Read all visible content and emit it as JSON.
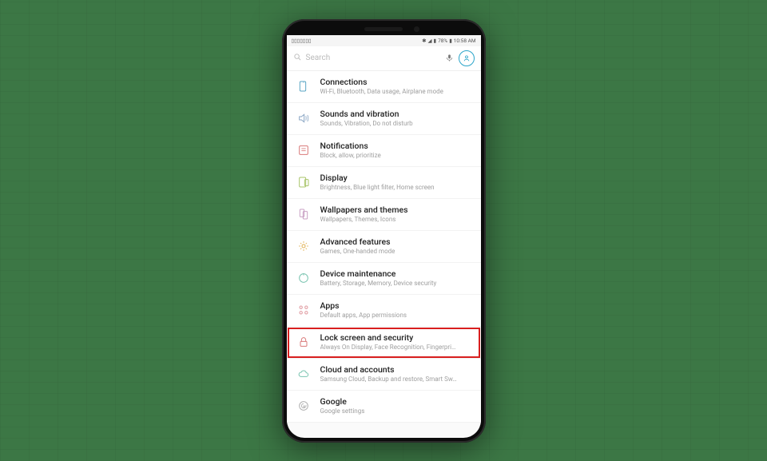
{
  "status": {
    "left_icons": [
      "f",
      "□",
      "□",
      "□",
      "□",
      "□",
      "□",
      "□",
      "•",
      "•"
    ],
    "right_text": "78%",
    "time": "10:58 AM"
  },
  "search": {
    "placeholder": "Search"
  },
  "settings": [
    {
      "title": "Connections",
      "sub": "Wi-Fi, Bluetooth, Data usage, Airplane mode",
      "icon": "connections",
      "color": "#5aa6c4"
    },
    {
      "title": "Sounds and vibration",
      "sub": "Sounds, Vibration, Do not disturb",
      "icon": "sound",
      "color": "#8aa6c4"
    },
    {
      "title": "Notifications",
      "sub": "Block, allow, prioritize",
      "icon": "notifications",
      "color": "#d97a7a"
    },
    {
      "title": "Display",
      "sub": "Brightness, Blue light filter, Home screen",
      "icon": "display",
      "color": "#a9c46a"
    },
    {
      "title": "Wallpapers and themes",
      "sub": "Wallpapers, Themes, Icons",
      "icon": "wallpaper",
      "color": "#c9a0c4"
    },
    {
      "title": "Advanced features",
      "sub": "Games, One-handed mode",
      "icon": "advanced",
      "color": "#e0b050"
    },
    {
      "title": "Device maintenance",
      "sub": "Battery, Storage, Memory, Device security",
      "icon": "maintenance",
      "color": "#7ac4b0"
    },
    {
      "title": "Apps",
      "sub": "Default apps, App permissions",
      "icon": "apps",
      "color": "#e09aa0"
    },
    {
      "title": "Lock screen and security",
      "sub": "Always On Display, Face Recognition, Fingerpri…",
      "icon": "lock",
      "color": "#d97a7a",
      "highlight": true
    },
    {
      "title": "Cloud and accounts",
      "sub": "Samsung Cloud, Backup and restore, Smart Sw…",
      "icon": "cloud",
      "color": "#7ac4b0"
    },
    {
      "title": "Google",
      "sub": "Google settings",
      "icon": "google",
      "color": "#b0b0b0"
    }
  ]
}
